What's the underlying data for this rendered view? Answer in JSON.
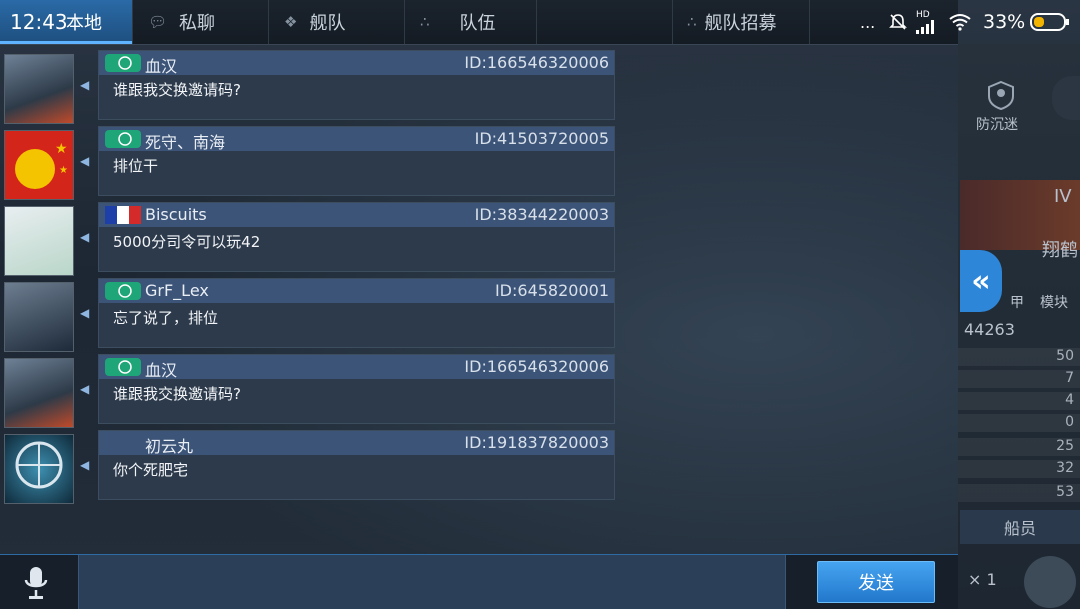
{
  "status_bar": {
    "time": "12:43",
    "battery": "33%",
    "signal": "HD",
    "dots": "..."
  },
  "tabs": [
    {
      "label": "本地",
      "active": true
    },
    {
      "label": "私聊",
      "active": false
    },
    {
      "label": "舰队",
      "active": false
    },
    {
      "label": "队伍",
      "active": false
    },
    {
      "label": "舰队招募",
      "active": false
    }
  ],
  "messages": [
    {
      "name": "血汉",
      "id": "ID:166546320006",
      "text": "谁跟我交换邀请码?",
      "flag": "green-badge",
      "avatar": "warship-avatar"
    },
    {
      "name": "死守、南海",
      "id": "ID:41503720005",
      "text": "排位干",
      "flag": "green-badge",
      "avatar": "red-flag-avatar"
    },
    {
      "name": "Biscuits",
      "id": "ID:38344220003",
      "text": "5000分司令可以玩42",
      "flag": "france-flag",
      "avatar": "anime-girl-avatar"
    },
    {
      "name": "GrF_Lex",
      "id": "ID:645820001",
      "text": "忘了说了，排位",
      "flag": "green-badge",
      "avatar": "anime-girl-avatar"
    },
    {
      "name": "血汉",
      "id": "ID:166546320006",
      "text": "谁跟我交换邀请码?",
      "flag": "green-badge",
      "avatar": "warship-avatar"
    },
    {
      "name": "初云丸",
      "id": "ID:191837820003",
      "text": "你个死肥宅",
      "flag": "none",
      "avatar": "helm-avatar"
    }
  ],
  "right_panel": {
    "label_top": "防沉迷",
    "level": "IV",
    "ship_name": "翔鹤",
    "labels_mid": [
      "甲",
      "模块"
    ],
    "score": "44263",
    "stat_values": [
      "50",
      "7",
      "4",
      "0",
      "25",
      "32",
      "53"
    ],
    "crew_label": "船员",
    "count": "× 1"
  },
  "input": {
    "send_label": "发送",
    "placeholder": ""
  },
  "colors": {
    "accent": "#2e86d8",
    "tab_active": "#2a6aa6",
    "bubble_header": "#3c5478"
  }
}
